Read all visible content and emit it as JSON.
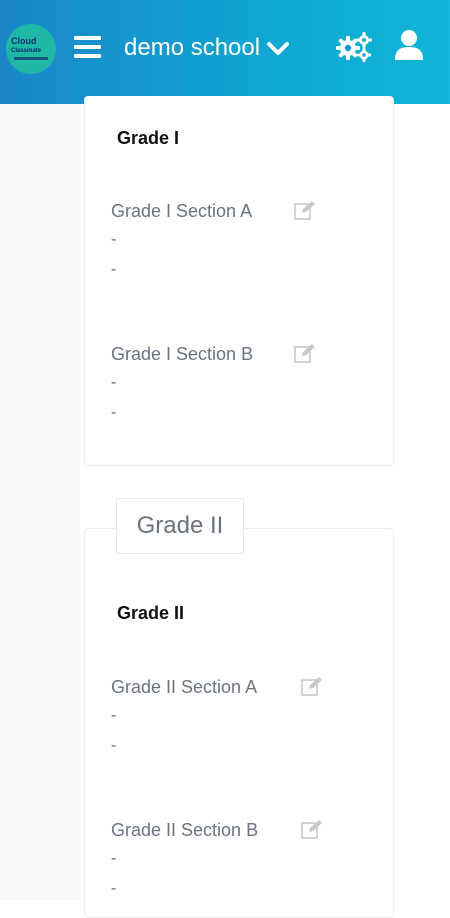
{
  "header": {
    "logo_line1": "Cloud",
    "logo_line2": "Classmate",
    "school_name": "demo school"
  },
  "groups": [
    {
      "tab_label": "",
      "title": "Grade I",
      "sections": [
        {
          "name": "Grade I Section A",
          "line1": "-",
          "line2": "-"
        },
        {
          "name": "Grade I Section B",
          "line1": "-",
          "line2": "-"
        }
      ]
    },
    {
      "tab_label": "Grade II",
      "title": "Grade II",
      "sections": [
        {
          "name": "Grade II Section A",
          "line1": "-",
          "line2": "-"
        },
        {
          "name": "Grade II Section B",
          "line1": "-",
          "line2": "-"
        }
      ]
    }
  ],
  "colors": {
    "header_start": "#1a86c8",
    "header_end": "#11b7d6",
    "section_text": "#6b7380"
  }
}
